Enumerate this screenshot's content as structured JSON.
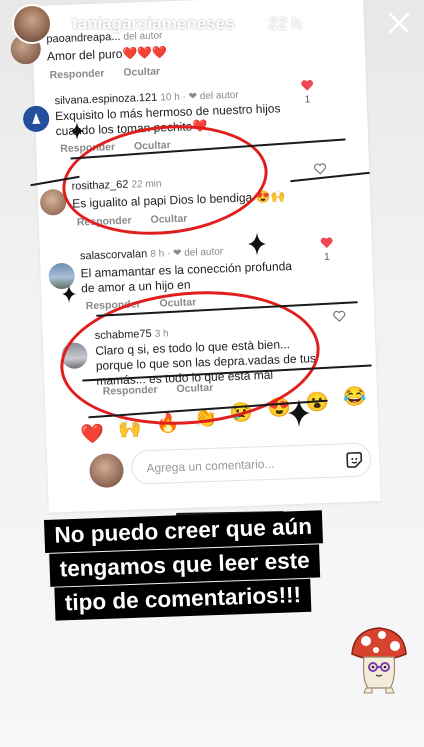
{
  "story": {
    "username": "taniagarciameneses",
    "time": "22 h",
    "close_icon": "close-icon",
    "caption_lines": [
      "No puedo creer que aún",
      "tengamos que leer este",
      "tipo de comentarios!!!"
    ],
    "sticker": "mushroom-character-sticker"
  },
  "comments": [
    {
      "user": "paoandreapa...",
      "meta": "del autor",
      "text": "Amor del puro❤️❤️❤️",
      "actions": [
        "Responder",
        "Ocultar"
      ],
      "likes": ""
    },
    {
      "user": "silvana.espinoza.121",
      "meta": "10 h · ❤ del autor",
      "text": "Exquisito lo más hermoso de nuestro hijos cuando los toman pechito❤️",
      "actions": [
        "Responder",
        "Ocultar"
      ],
      "likes": "1"
    },
    {
      "user": "rosithaz_62",
      "meta": "22 min",
      "text": "Es igualito al papi Dios lo bendiga 😍🙌",
      "actions": [
        "Responder",
        "Ocultar"
      ],
      "likes": ""
    },
    {
      "user": "salascorvalan",
      "meta": "8 h · ❤ del autor",
      "text": "El amamantar es la conección profunda de amor a un hijo en",
      "actions": [
        "Responder",
        "Ocultar"
      ],
      "likes": "1"
    },
    {
      "user": "schabme75",
      "meta": "3 h",
      "text": "Claro q si, es todo lo que està bien... porque lo que son las depra.vadas de tus mamás... es todo lo que està mal",
      "actions": [
        "Responder",
        "Ocultar"
      ],
      "likes": ""
    }
  ],
  "reactions": [
    "❤️",
    "🙌",
    "🔥",
    "👏",
    "😢",
    "😍",
    "😮",
    "😂"
  ],
  "comment_input": {
    "placeholder": "Agrega un comentario..."
  },
  "colors": {
    "accent_red": "#e01e1e",
    "heart_red": "#ed4956",
    "caption_bg": "#000000"
  }
}
